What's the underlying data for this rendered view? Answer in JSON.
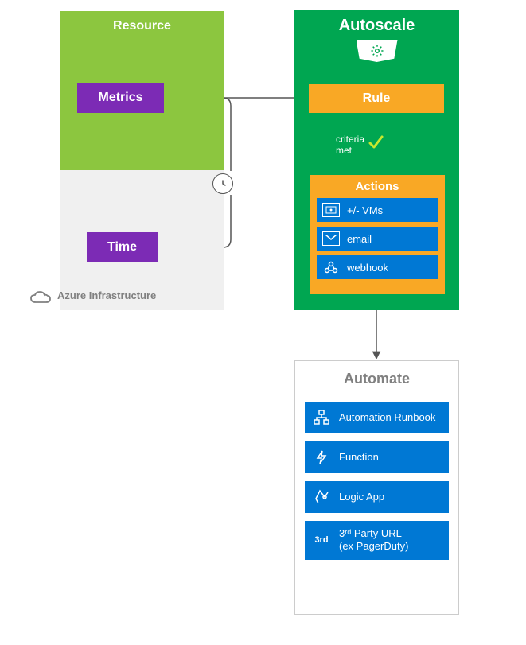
{
  "resource": {
    "title": "Resource",
    "metrics": "Metrics"
  },
  "time": {
    "label": "Time"
  },
  "infra": {
    "label": "Azure Infrastructure"
  },
  "autoscale": {
    "title": "Autoscale",
    "rule": "Rule",
    "criteria": "criteria\nmet",
    "actions_title": "Actions",
    "actions": [
      {
        "icon": "vm-icon",
        "label": "+/- VMs"
      },
      {
        "icon": "email-icon",
        "label": "email"
      },
      {
        "icon": "webhook-icon",
        "label": "webhook"
      }
    ]
  },
  "automate": {
    "title": "Automate",
    "items": [
      {
        "icon": "runbook-icon",
        "label": "Automation Runbook"
      },
      {
        "icon": "function-icon",
        "label": "Function"
      },
      {
        "icon": "logicapp-icon",
        "label": "Logic App"
      },
      {
        "icon": "thirdparty-icon",
        "icon_text": "3rd",
        "label": "3ʳᵈ Party URL\n(ex PagerDuty)"
      }
    ]
  },
  "colors": {
    "green_light": "#8cc63f",
    "green_dark": "#00a651",
    "purple": "#7c2bb5",
    "orange": "#f9a825",
    "blue": "#0078d4",
    "gray_bg": "#f0f0f0"
  }
}
